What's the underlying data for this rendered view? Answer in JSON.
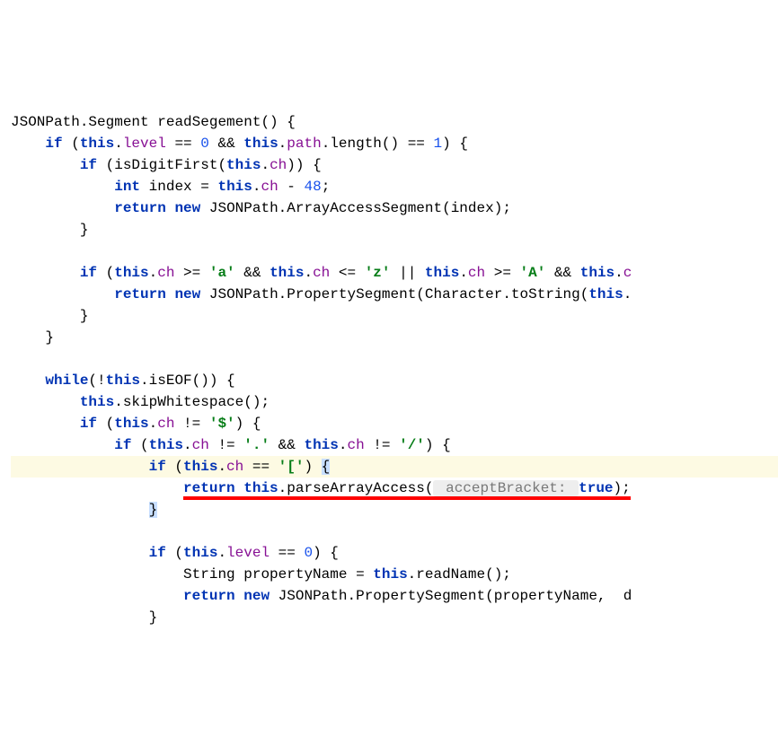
{
  "line1": {
    "type": "JSONPath.Segment",
    "method": "readSegement",
    "paren": "() {"
  },
  "line2": {
    "if": "if",
    "p1": " (",
    "this": "this",
    "dot": ".",
    "field1": "level",
    "eq": " == ",
    "zero": "0",
    "and": " && ",
    "this2": "this",
    "dot2": ".",
    "field2": "path",
    "call": ".length() == ",
    "one": "1",
    "close": ") {"
  },
  "line3": {
    "if": "if",
    "p1": " (isDigitFirst(",
    "this": "this",
    "dot": ".",
    "field": "ch",
    "close": ")) {"
  },
  "line4": {
    "int": "int",
    "sp": " ",
    "var": "index",
    "eq": " = ",
    "this": "this",
    "dot": ".",
    "field": "ch",
    "minus": " - ",
    "num": "48",
    "semi": ";"
  },
  "line5": {
    "ret": "return",
    "sp": " ",
    "new": "new",
    "sp2": " ",
    "cls": "JSONPath.ArrayAccessSegment(index);"
  },
  "line6": "}",
  "line8": {
    "if": "if",
    "p1": " (",
    "this": "this",
    "dot": ".",
    "field": "ch",
    "ge": " >= ",
    "a": "'a'",
    "and": " && ",
    "this2": "this",
    "dot2": ".",
    "field2": "ch",
    "le": " <= ",
    "z": "'z'",
    "or": " || ",
    "this3": "this",
    "dot3": ".",
    "field3": "ch",
    "ge2": " >= ",
    "A": "'A'",
    "and2": " && ",
    "this4": "this",
    "dot4": ".",
    "field4": "c"
  },
  "line9": {
    "ret": "return",
    "sp": " ",
    "new": "new",
    "sp2": " ",
    "cls": "JSONPath.PropertySegment(Character.toString(",
    "this": "this",
    "dot": "."
  },
  "line10": "}",
  "line11": "}",
  "line13": {
    "while": "while",
    "p1": "(!",
    "this": "this",
    "call": ".isEOF()) {"
  },
  "line14": {
    "this": "this",
    "call": ".skipWhitespace();"
  },
  "line15": {
    "if": "if",
    "p1": " (",
    "this": "this",
    "dot": ".",
    "field": "ch",
    "ne": " != ",
    "dollar": "'$'",
    "close": ") {"
  },
  "line16": {
    "if": "if",
    "p1": " (",
    "this": "this",
    "dot": ".",
    "field": "ch",
    "ne": " != ",
    "dotc": "'.'",
    "and": " && ",
    "this2": "this",
    "dot2": ".",
    "field2": "ch",
    "ne2": " != ",
    "slash": "'/'",
    "close": ") {"
  },
  "line17": {
    "if": "if",
    "p1": " (",
    "this": "this",
    "dot": ".",
    "field": "ch",
    "eq": " == ",
    "br": "'['",
    "close": ") ",
    "brace": "{"
  },
  "line18": {
    "ret": "return",
    "sp": " ",
    "this": "this",
    "call": ".parseArrayAccess(",
    "hint": " acceptBracket: ",
    "true": "true",
    "close": ");"
  },
  "line19": "}",
  "line21": {
    "if": "if",
    "p1": " (",
    "this": "this",
    "dot": ".",
    "field": "level",
    "eq": " == ",
    "zero": "0",
    "close": ") {"
  },
  "line22": {
    "type": "String propertyName = ",
    "this": "this",
    "call": ".readName();"
  },
  "line23": {
    "ret": "return",
    "sp": " ",
    "new": "new",
    "sp2": " ",
    "cls": "JSONPath.PropertySegment(propertyName,  d"
  },
  "line24": "}"
}
